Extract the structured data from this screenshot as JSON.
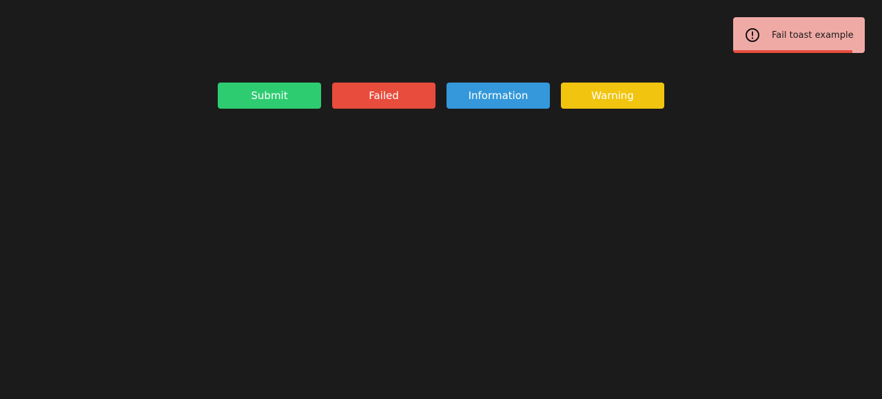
{
  "buttons": {
    "submit_label": "Submit",
    "failed_label": "Failed",
    "information_label": "Information",
    "warning_label": "Warning"
  },
  "toast": {
    "message": "Fail toast example",
    "icon": "alert-circle-icon",
    "progress_fraction": 0.906,
    "background_color": "#f0aaa6",
    "progress_color": "#e74c3c"
  },
  "colors": {
    "page_background": "#1b1b1b",
    "submit": "#2ecc71",
    "failed": "#e74c3c",
    "information": "#3498db",
    "warning": "#f1c40f"
  }
}
